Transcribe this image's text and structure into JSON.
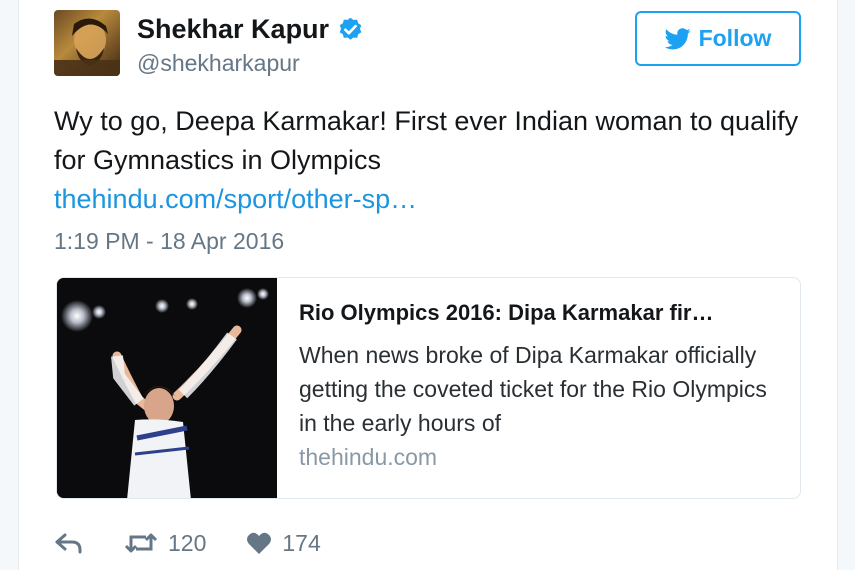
{
  "user": {
    "name": "Shekhar Kapur",
    "handle": "@shekharkapur",
    "avatar_icon": "profile-photo"
  },
  "follow_button": {
    "label": "Follow",
    "icon": "twitter-bird-icon"
  },
  "tweet": {
    "text": "Wy to go, Deepa Karmakar! First ever Indian woman to qualify for Gymnastics in Olympics",
    "link": "thehindu.com/sport/other-sp…",
    "timestamp": "1:19 PM - 18 Apr 2016"
  },
  "link_card": {
    "title": "Rio Olympics 2016: Dipa Karmakar fir…",
    "description": "When news broke of Dipa Karmakar officially getting the coveted ticket for the Rio Olympics in the early hours of",
    "domain": "thehindu.com"
  },
  "actions": {
    "reply_icon": "reply-icon",
    "retweet_count": "120",
    "like_count": "174"
  },
  "colors": {
    "accent": "#1da1f2",
    "link": "#1b95e0",
    "muted": "#657786"
  }
}
